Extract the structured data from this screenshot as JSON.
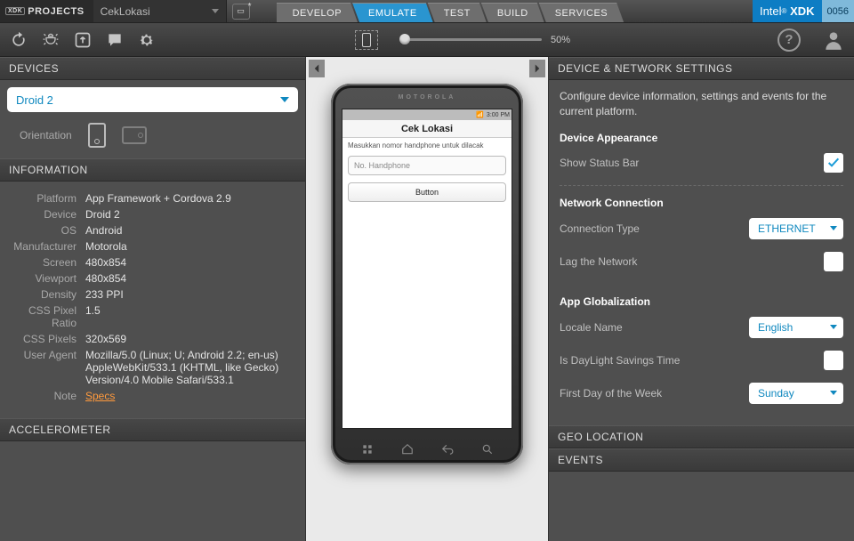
{
  "topbar": {
    "projects_label": "PROJECTS",
    "project_name": "CekLokasi",
    "brand_prefix": "Intel",
    "brand_suffix": "XDK",
    "build_number": "0056",
    "tabs": [
      {
        "label": "DEVELOP"
      },
      {
        "label": "EMULATE",
        "active": true
      },
      {
        "label": "TEST"
      },
      {
        "label": "BUILD"
      },
      {
        "label": "SERVICES"
      }
    ]
  },
  "toolbar": {
    "zoom": "50%"
  },
  "left": {
    "devices_header": "DEVICES",
    "information_header": "INFORMATION",
    "accelerometer_header": "ACCELEROMETER",
    "device_selected": "Droid 2",
    "orientation_label": "Orientation",
    "info": [
      {
        "label": "Platform",
        "value": "App Framework + Cordova 2.9"
      },
      {
        "label": "Device",
        "value": "Droid 2"
      },
      {
        "label": "OS",
        "value": "Android"
      },
      {
        "label": "Manufacturer",
        "value": "Motorola"
      },
      {
        "label": "Screen",
        "value": "480x854"
      },
      {
        "label": "Viewport",
        "value": "480x854"
      },
      {
        "label": "Density",
        "value": "233 PPI"
      },
      {
        "label": "CSS Pixel Ratio",
        "value": "1.5"
      },
      {
        "label": "CSS Pixels",
        "value": "320x569"
      },
      {
        "label": "User Agent",
        "value": "Mozilla/5.0 (Linux; U; Android 2.2; en-us) AppleWebKit/533.1 (KHTML, like Gecko) Version/4.0 Mobile Safari/533.1"
      },
      {
        "label": "Note",
        "link": "Specs"
      }
    ]
  },
  "phone": {
    "brand": "MOTOROLA",
    "status_time": "3:00 PM",
    "app_title": "Cek Lokasi",
    "app_instruction": "Masukkan nomor handphone untuk dilacak",
    "input_placeholder": "No. Handphone",
    "button_label": "Button"
  },
  "right": {
    "header": "DEVICE & NETWORK SETTINGS",
    "events_header": "EVENTS",
    "geo_header": "GEO LOCATION",
    "description": "Configure device information, settings and events for the current platform.",
    "appearance_title": "Device Appearance",
    "show_status_bar": "Show Status Bar",
    "network_title": "Network Connection",
    "connection_type_label": "Connection Type",
    "connection_type_value": "ETHERNET",
    "lag_network": "Lag the Network",
    "globalization_title": "App Globalization",
    "locale_label": "Locale Name",
    "locale_value": "English",
    "dst_label": "Is DayLight Savings Time",
    "first_day_label": "First Day of the Week",
    "first_day_value": "Sunday"
  }
}
